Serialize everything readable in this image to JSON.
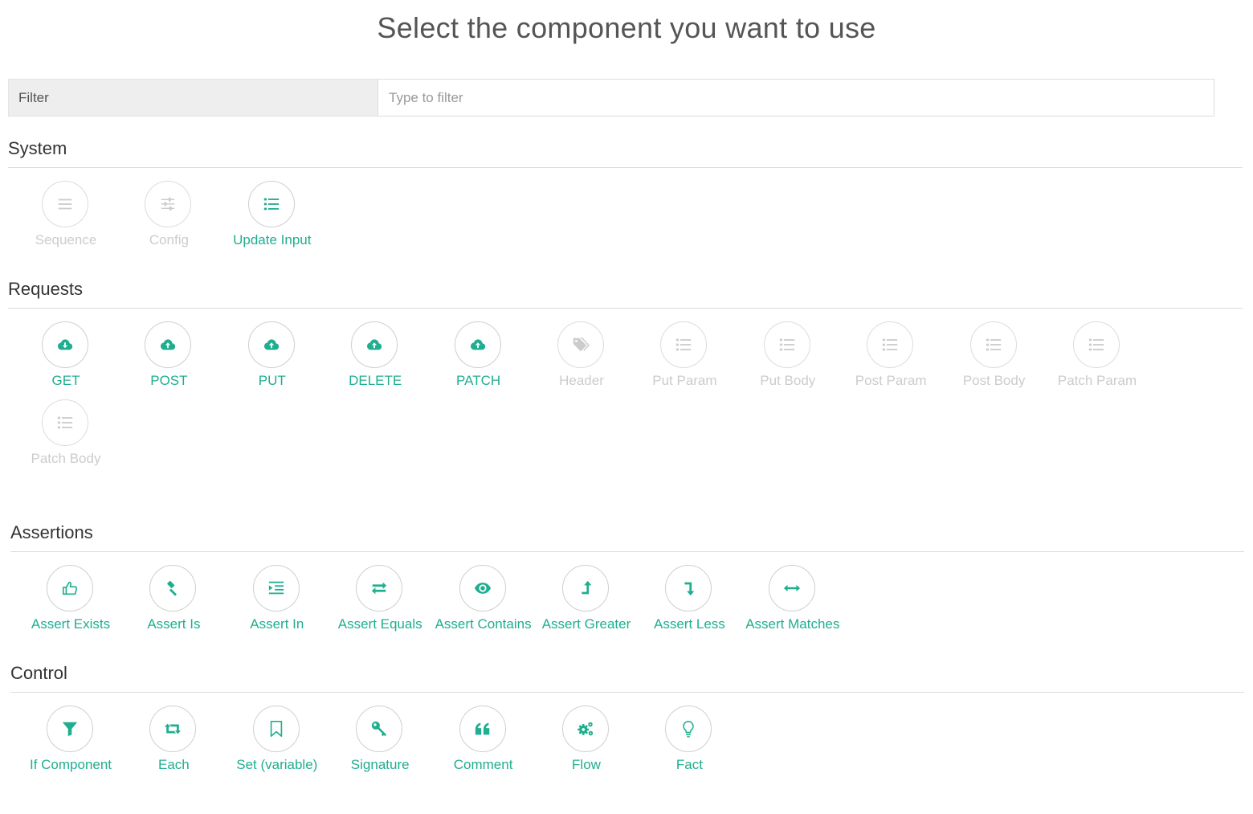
{
  "page": {
    "title": "Select the component you want to use"
  },
  "filter": {
    "label": "Filter",
    "placeholder": "Type to filter"
  },
  "colors": {
    "accent": "#1fae8f",
    "disabled": "#cccccc"
  },
  "sections": [
    {
      "title": "System",
      "items": [
        {
          "label": "Sequence",
          "icon": "bars-icon",
          "enabled": false
        },
        {
          "label": "Config",
          "icon": "sliders-icon",
          "enabled": false
        },
        {
          "label": "Update Input",
          "icon": "list-icon",
          "enabled": true
        }
      ]
    },
    {
      "title": "Requests",
      "items": [
        {
          "label": "GET",
          "icon": "cloud-download-icon",
          "enabled": true
        },
        {
          "label": "POST",
          "icon": "cloud-upload-icon",
          "enabled": true
        },
        {
          "label": "PUT",
          "icon": "cloud-upload-icon",
          "enabled": true
        },
        {
          "label": "DELETE",
          "icon": "cloud-upload-icon",
          "enabled": true
        },
        {
          "label": "PATCH",
          "icon": "cloud-upload-icon",
          "enabled": true
        },
        {
          "label": "Header",
          "icon": "tags-icon",
          "enabled": false
        },
        {
          "label": "Put Param",
          "icon": "list-icon",
          "enabled": false
        },
        {
          "label": "Put Body",
          "icon": "list-icon",
          "enabled": false
        },
        {
          "label": "Post Param",
          "icon": "list-icon",
          "enabled": false
        },
        {
          "label": "Post Body",
          "icon": "list-icon",
          "enabled": false
        },
        {
          "label": "Patch Param",
          "icon": "list-icon",
          "enabled": false
        },
        {
          "label": "Patch Body",
          "icon": "list-icon",
          "enabled": false
        }
      ]
    },
    {
      "title": "Assertions",
      "items": [
        {
          "label": "Assert Exists",
          "icon": "thumbs-up-icon",
          "enabled": true
        },
        {
          "label": "Assert Is",
          "icon": "gavel-icon",
          "enabled": true
        },
        {
          "label": "Assert In",
          "icon": "indent-icon",
          "enabled": true
        },
        {
          "label": "Assert Equals",
          "icon": "exchange-icon",
          "enabled": true
        },
        {
          "label": "Assert Contains",
          "icon": "eye-icon",
          "enabled": true
        },
        {
          "label": "Assert Greater",
          "icon": "level-up-icon",
          "enabled": true
        },
        {
          "label": "Assert Less",
          "icon": "level-down-icon",
          "enabled": true
        },
        {
          "label": "Assert Matches",
          "icon": "arrows-h-icon",
          "enabled": true
        }
      ]
    },
    {
      "title": "Control",
      "items": [
        {
          "label": "If Component",
          "icon": "filter-icon",
          "enabled": true
        },
        {
          "label": "Each",
          "icon": "retweet-icon",
          "enabled": true
        },
        {
          "label": "Set (variable)",
          "icon": "bookmark-icon",
          "enabled": true
        },
        {
          "label": "Signature",
          "icon": "key-icon",
          "enabled": true
        },
        {
          "label": "Comment",
          "icon": "quote-icon",
          "enabled": true
        },
        {
          "label": "Flow",
          "icon": "cogs-icon",
          "enabled": true
        },
        {
          "label": "Fact",
          "icon": "lightbulb-icon",
          "enabled": true
        }
      ]
    }
  ]
}
